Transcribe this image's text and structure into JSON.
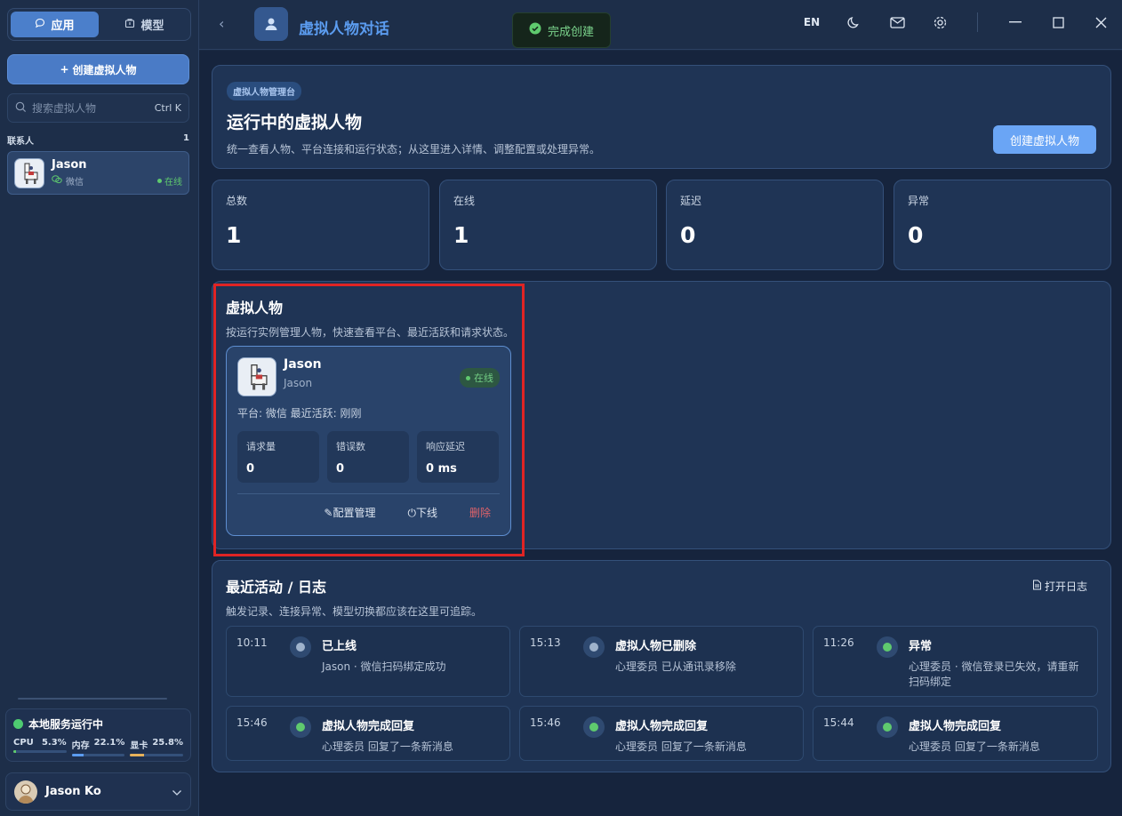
{
  "sidebar": {
    "tabs": [
      {
        "label": "应用"
      },
      {
        "label": "模型"
      }
    ],
    "create_label": "创建虚拟人物",
    "search": {
      "placeholder": "搜索虚拟人物",
      "shortcut": "Ctrl K"
    },
    "contacts_label": "联系人",
    "contacts_count": "1",
    "contact": {
      "name": "Jason",
      "platform": "微信",
      "status": "在线"
    },
    "service": {
      "title": "本地服务运行中",
      "meters": [
        {
          "label": "CPU",
          "value": "5.3%",
          "fraction": 0.053,
          "color": "#5fca6e"
        },
        {
          "label": "内存",
          "value": "22.1%",
          "fraction": 0.221,
          "color": "#5b9cf0"
        },
        {
          "label": "显卡",
          "value": "25.8%",
          "fraction": 0.258,
          "color": "#e6b15a"
        }
      ]
    },
    "user": {
      "name": "Jason Ko"
    }
  },
  "topbar": {
    "title": "虚拟人物对话",
    "toast": "完成创建",
    "lang": "EN"
  },
  "hero": {
    "badge": "虚拟人物管理台",
    "title": "运行中的虚拟人物",
    "desc": "统一查看人物、平台连接和运行状态；从这里进入详情、调整配置或处理异常。",
    "button": "创建虚拟人物"
  },
  "stats": [
    {
      "label": "总数",
      "value": "1"
    },
    {
      "label": "在线",
      "value": "1"
    },
    {
      "label": "延迟",
      "value": "0"
    },
    {
      "label": "异常",
      "value": "0"
    }
  ],
  "personas": {
    "title": "虚拟人物",
    "desc": "按运行实例管理人物，快速查看平台、最近活跃和请求状态。",
    "card": {
      "name": "Jason",
      "subname": "Jason",
      "status": "在线",
      "meta": "平台: 微信   最近活跃: 刚刚",
      "metrics": [
        {
          "label": "请求量",
          "value": "0"
        },
        {
          "label": "错误数",
          "value": "0"
        },
        {
          "label": "响应延迟",
          "value": "0 ms"
        }
      ],
      "actions": {
        "config": "配置管理",
        "offline": "下线",
        "delete": "删除"
      }
    }
  },
  "logs": {
    "title": "最近活动 / 日志",
    "desc": "触发记录、连接异常、模型切换都应该在这里可追踪。",
    "open": "打开日志",
    "items": [
      {
        "time": "10:11",
        "title": "已上线",
        "desc": "Jason · 微信扫码绑定成功",
        "color": "#9fb3cc"
      },
      {
        "time": "15:13",
        "title": "虚拟人物已删除",
        "desc": "心理委员 已从通讯录移除",
        "color": "#9fb3cc"
      },
      {
        "time": "11:26",
        "title": "异常",
        "desc": "心理委员 · 微信登录已失效，请重新扫码绑定",
        "color": "#5fca6e"
      },
      {
        "time": "15:46",
        "title": "虚拟人物完成回复",
        "desc": "心理委员 回复了一条新消息",
        "color": "#5fca6e"
      },
      {
        "time": "15:46",
        "title": "虚拟人物完成回复",
        "desc": "心理委员 回复了一条新消息",
        "color": "#5fca6e"
      },
      {
        "time": "15:44",
        "title": "虚拟人物完成回复",
        "desc": "心理委员 回复了一条新消息",
        "color": "#5fca6e"
      }
    ]
  }
}
